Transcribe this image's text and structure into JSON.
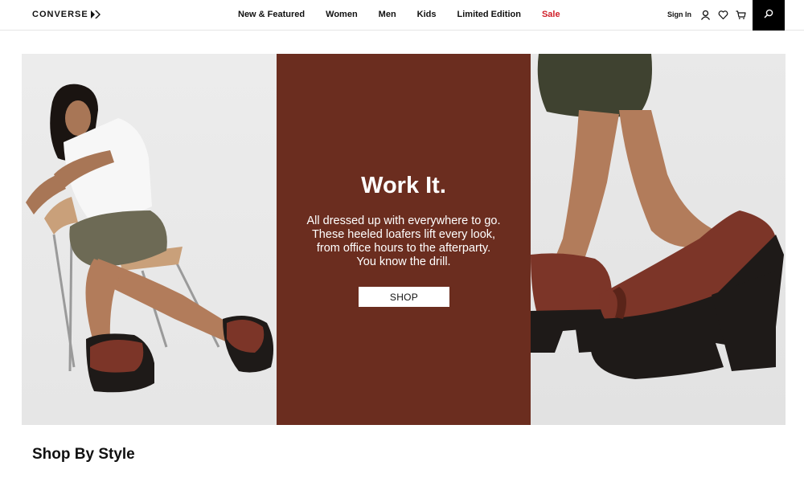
{
  "header": {
    "logo_text": "CONVERSE",
    "nav": [
      {
        "label": "New & Featured"
      },
      {
        "label": "Women"
      },
      {
        "label": "Men"
      },
      {
        "label": "Kids"
      },
      {
        "label": "Limited Edition"
      },
      {
        "label": "Sale"
      }
    ],
    "sign_in": "Sign In",
    "icons": [
      "user-icon",
      "heart-icon",
      "cart-icon",
      "search-icon"
    ],
    "sale_color": "#d0202a"
  },
  "hero": {
    "title": "Work It.",
    "text": "All dressed up with everywhere to go. These heeled loafers lift every look, from office hours to the afterparty. You know the drill.",
    "button": "SHOP",
    "panel_color": "#6b2d1f"
  },
  "section": {
    "title": "Shop By Style"
  }
}
